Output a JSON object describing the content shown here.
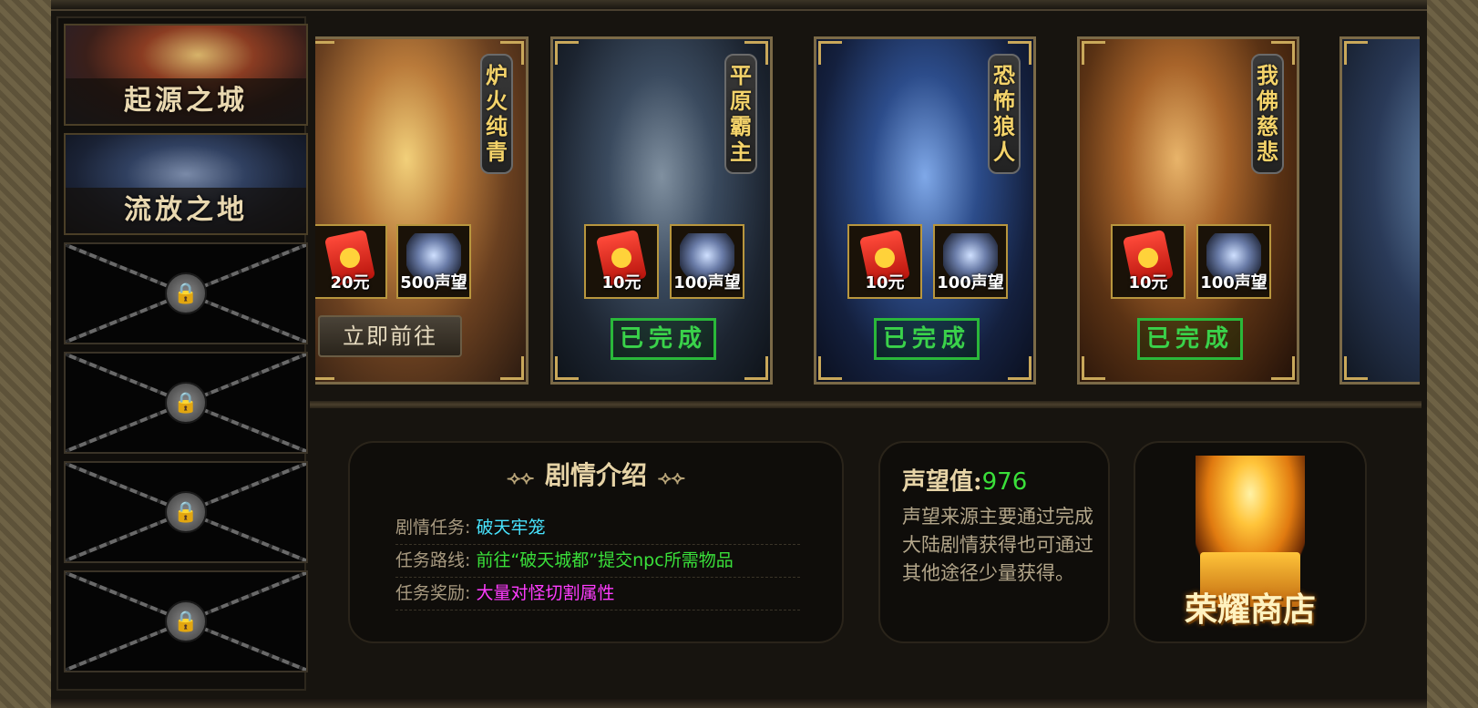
{
  "sidebar": {
    "items": [
      {
        "label": "起源之城",
        "state": "unlocked"
      },
      {
        "label": "流放之地",
        "state": "unlocked"
      },
      {
        "label": "",
        "state": "locked"
      },
      {
        "label": "",
        "state": "locked"
      },
      {
        "label": "",
        "state": "locked"
      },
      {
        "label": "",
        "state": "locked"
      }
    ]
  },
  "cards": [
    {
      "title": "炉火纯青",
      "red_packet": "20元",
      "reputation": "500声望",
      "action": "立即前往",
      "status": "pending"
    },
    {
      "title": "平原霸主",
      "red_packet": "10元",
      "reputation": "100声望",
      "action": "已完成",
      "status": "done"
    },
    {
      "title": "恐怖狼人",
      "red_packet": "10元",
      "reputation": "100声望",
      "action": "已完成",
      "status": "done"
    },
    {
      "title": "我佛慈悲",
      "red_packet": "10元",
      "reputation": "100声望",
      "action": "已完成",
      "status": "done"
    }
  ],
  "story": {
    "title": "剧情介绍",
    "rows": [
      {
        "label": "剧情任务:",
        "value": "破天牢笼",
        "color": "#48e4ff"
      },
      {
        "label": "任务路线:",
        "value": "前往“破天城都”提交npc所需物品",
        "color": "#3ae03a"
      },
      {
        "label": "任务奖励:",
        "value": "大量对怪切割属性",
        "color": "#ff3cff"
      }
    ]
  },
  "fame": {
    "label": "声望值:",
    "value": "976",
    "desc": "声望来源主要通过完成大陆剧情获得也可通过其他途径少量获得。"
  },
  "shop": {
    "label": "荣耀商店",
    "icon": "golden-dragon-icon"
  }
}
